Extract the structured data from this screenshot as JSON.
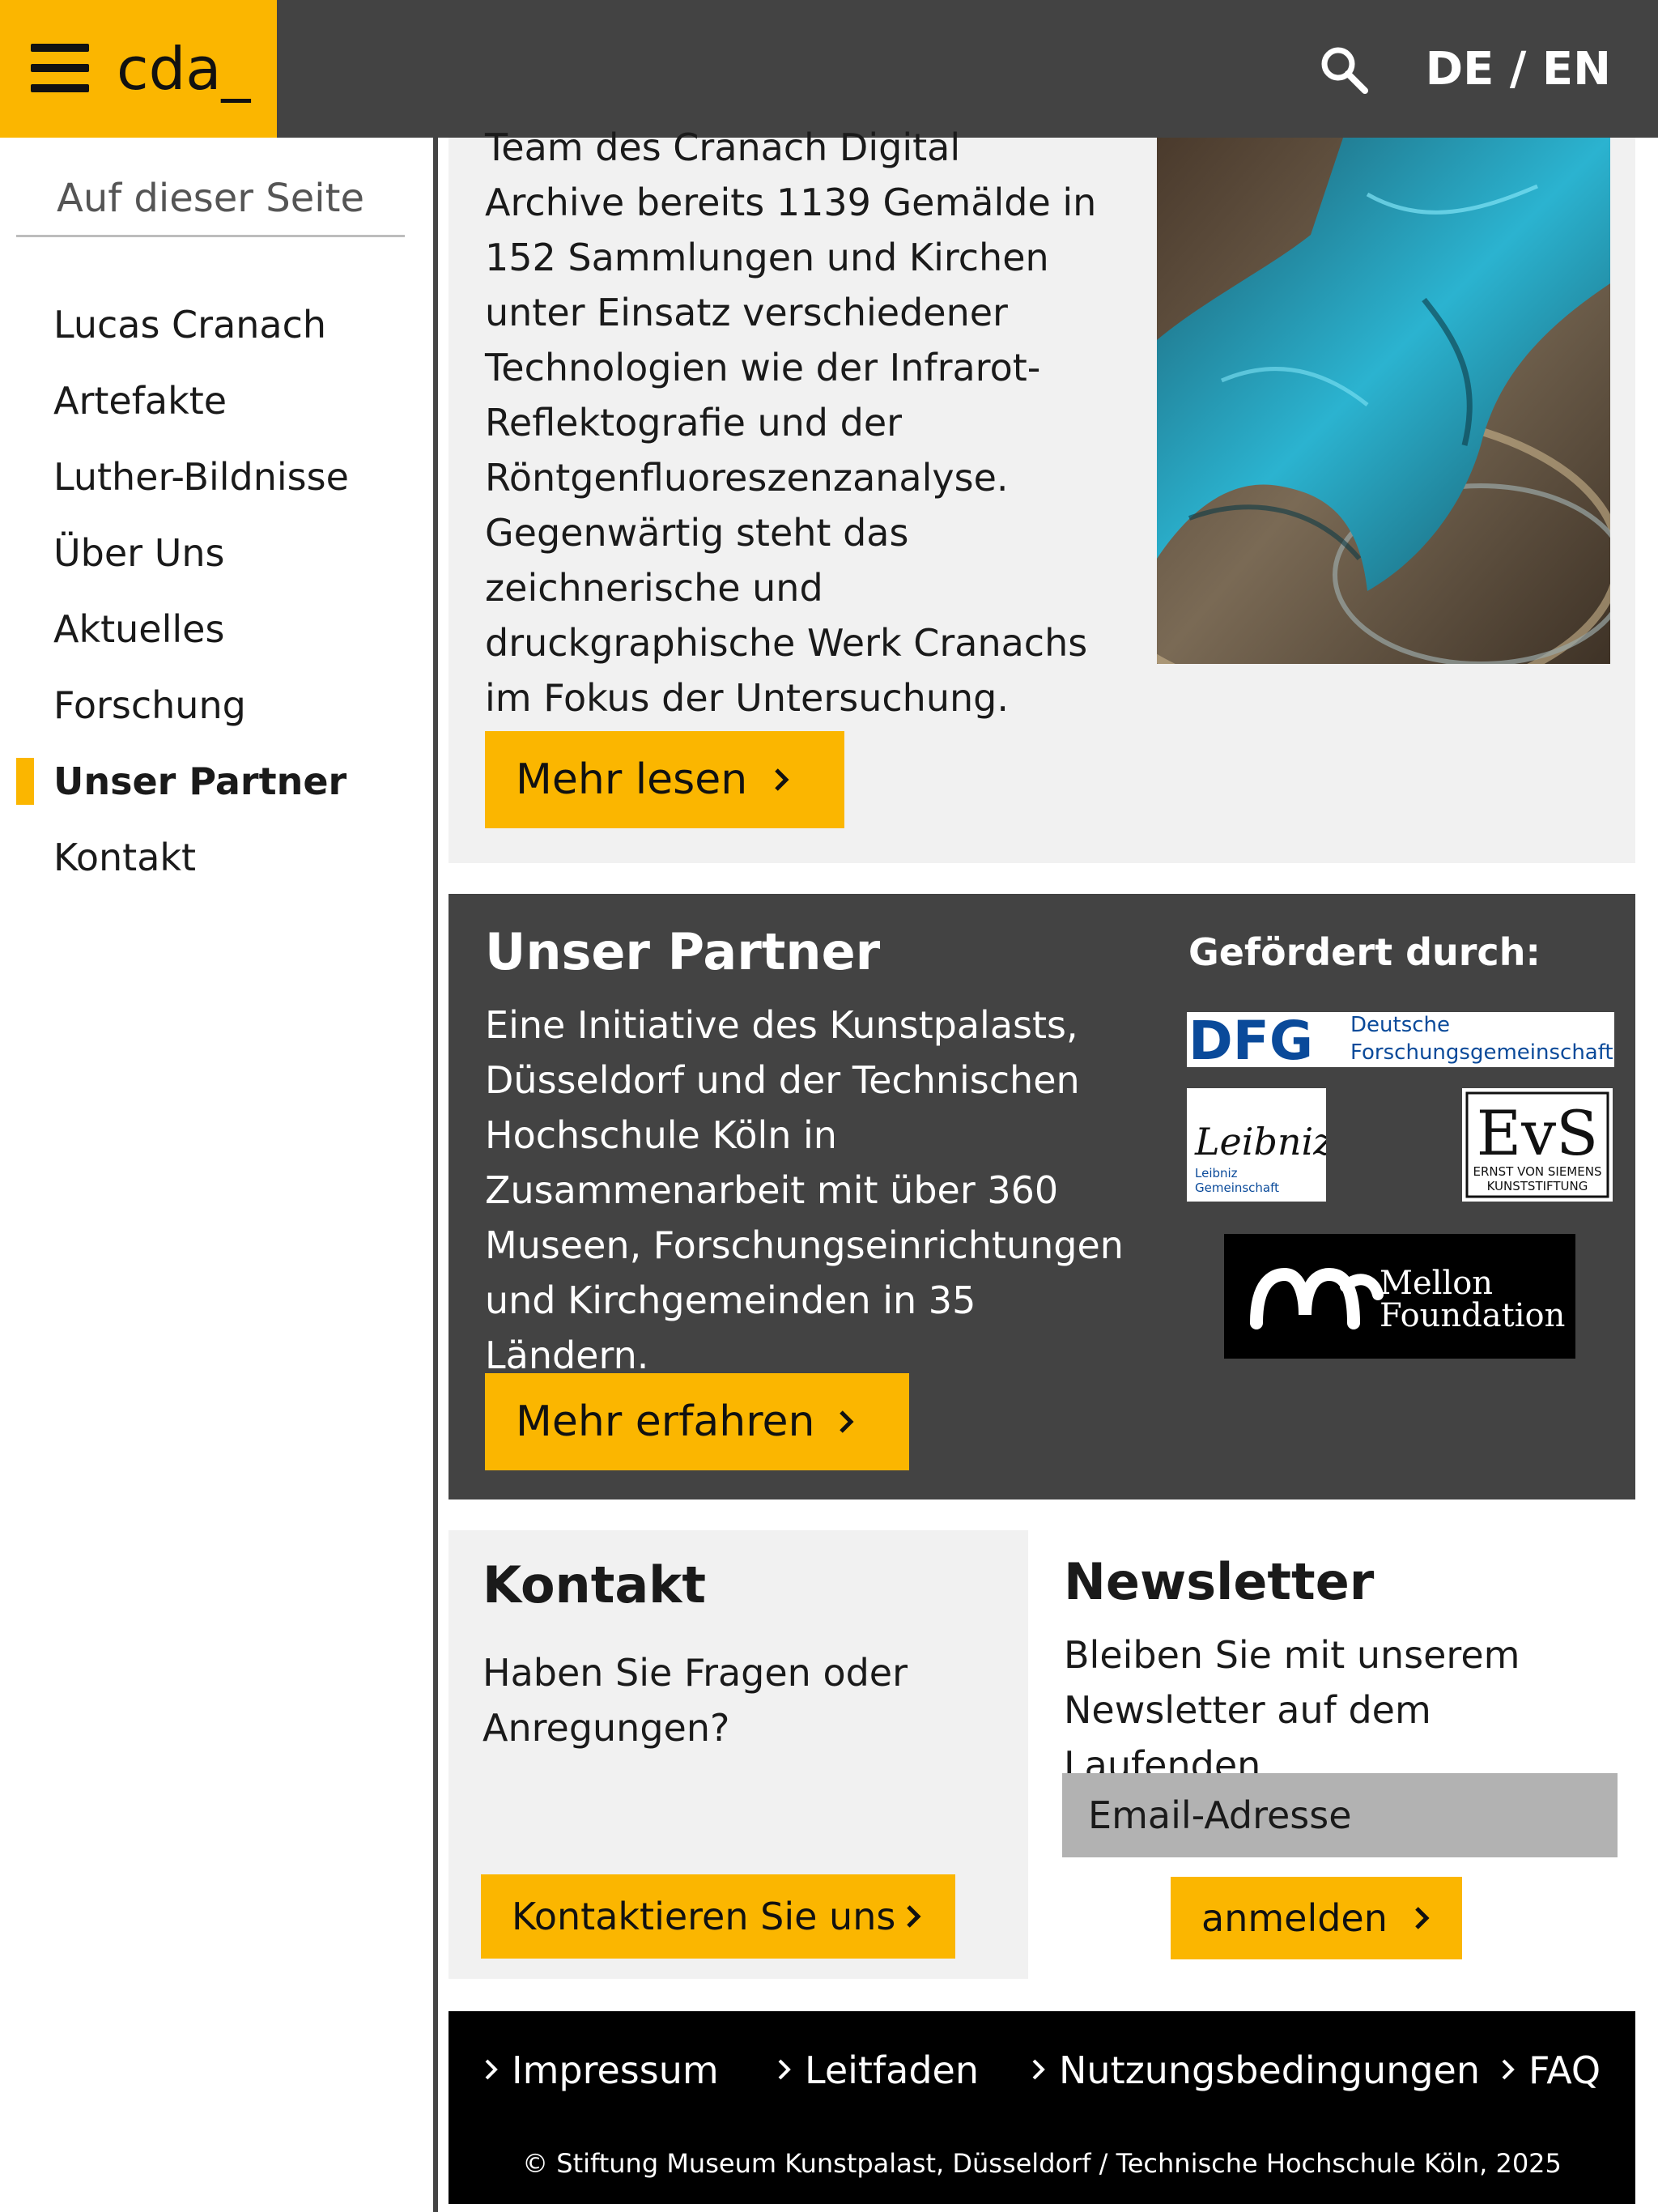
{
  "header": {
    "brand": "cda_",
    "lang_de": "DE",
    "lang_sep": " / ",
    "lang_en": "EN",
    "accent_color": "#fbb600",
    "bar_color": "#434343"
  },
  "sidebar": {
    "heading": "Auf dieser Seite",
    "items": [
      {
        "label": "Lucas Cranach",
        "active": false
      },
      {
        "label": "Artefakte",
        "active": false
      },
      {
        "label": "Luther-Bildnisse",
        "active": false
      },
      {
        "label": "Über Uns",
        "active": false
      },
      {
        "label": "Aktuelles",
        "active": false
      },
      {
        "label": "Forschung",
        "active": false
      },
      {
        "label": "Unser Partner",
        "active": true
      },
      {
        "label": "Kontakt",
        "active": false
      }
    ]
  },
  "intro": {
    "text": "Team des Cranach Digital Archive bereits 1139 Gemälde in 152 Sammlungen und Kirchen unter Einsatz verschiedener Technologien wie der Infrarot-Reflektografie und der Röntgenfluoreszenzanalyse. Gegenwärtig steht das zeichnerische und druckgraphische Werk Cranachs im Fokus der Untersuchung.",
    "button": "Mehr lesen"
  },
  "partner": {
    "title": "Unser Partner",
    "text": "Eine Initiative des Kunstpalasts, Düsseldorf und der Technischen Hochschule Köln in Zusammenarbeit mit über 360 Museen, Forschungseinrichtungen und Kirchgemeinden in 35 Ländern.",
    "button": "Mehr erfahren",
    "funded_by": "Gefördert durch:",
    "logos": {
      "dfg_mark": "DFG",
      "dfg_name_1": "Deutsche",
      "dfg_name_2": "Forschungsgemeinschaft",
      "leibniz_sig": "Leibniz",
      "leibniz_1": "Leibniz",
      "leibniz_2": "Gemeinschaft",
      "evs_mark": "EvS",
      "evs_1": "ERNST VON SIEMENS",
      "evs_2": "KUNSTSTIFTUNG",
      "mellon_1": "Mellon",
      "mellon_2": "Foundation"
    }
  },
  "kontakt": {
    "title": "Kontakt",
    "text": "Haben Sie Fragen oder Anregungen?",
    "button": "Kontaktieren Sie uns"
  },
  "newsletter": {
    "title": "Newsletter",
    "text": "Bleiben Sie mit unserem Newsletter auf dem Laufenden.",
    "placeholder": "Email-Adresse",
    "button": "anmelden"
  },
  "footer": {
    "links": [
      "Impressum",
      "Leitfaden",
      "Nutzungsbedingungen",
      "FAQ"
    ],
    "copyright": "© Stiftung Museum Kunstpalast, Düsseldorf / Technische Hochschule Köln, 2025"
  }
}
